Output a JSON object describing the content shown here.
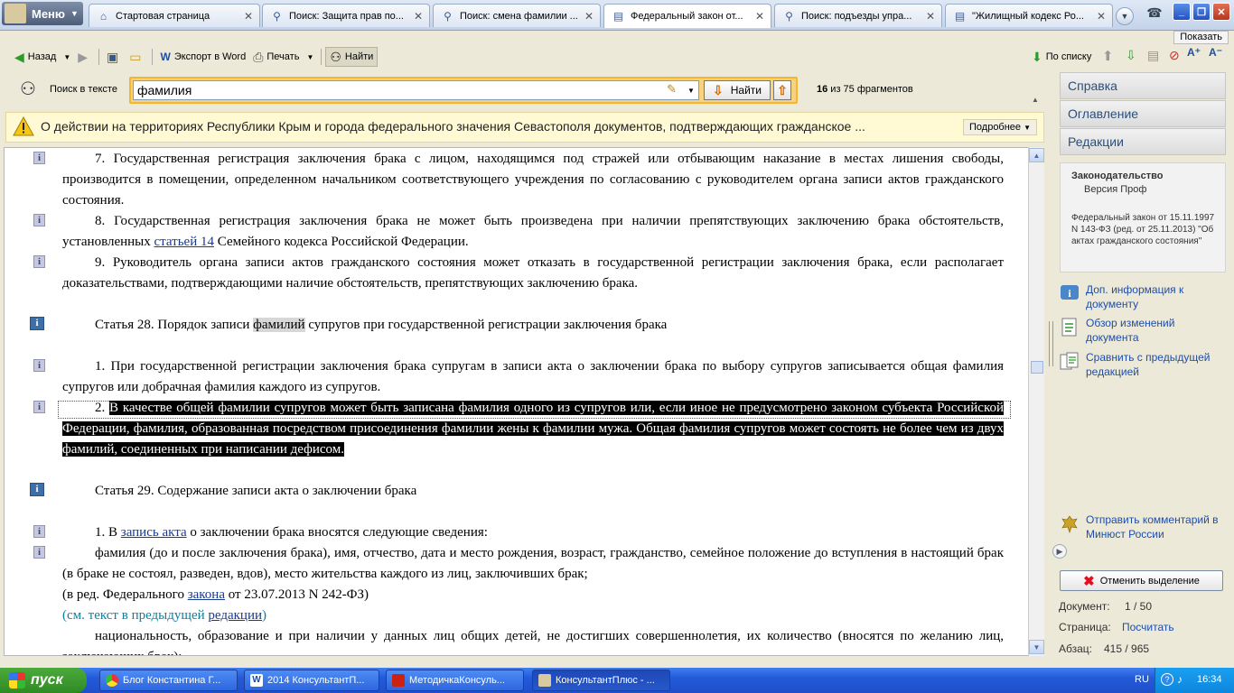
{
  "tabs": {
    "menu_label": "Меню",
    "items": [
      {
        "label": "Стартовая страница"
      },
      {
        "label": "Поиск: Защита прав по..."
      },
      {
        "label": "Поиск: смена фамилии ..."
      },
      {
        "label": "Федеральный закон от..."
      },
      {
        "label": "Поиск: подъезды упра..."
      },
      {
        "label": "\"Жилищный кодекс Ро..."
      }
    ]
  },
  "show_label": "Показать",
  "toolbar": {
    "back": "Назад",
    "export_word": "Экспорт в Word",
    "print": "Печать",
    "find": "Найти",
    "by_list": "По списку"
  },
  "search": {
    "label": "Поиск в тексте",
    "value": "фамилия",
    "find_btn": "Найти",
    "count_current": "16",
    "count_rest": " из 75 фрагментов"
  },
  "notice": {
    "text": "О действии на территориях Республики Крым и города федерального значения Севастополя документов, подтверждающих гражданское ...",
    "more": "Подробнее"
  },
  "document": {
    "p7": "7. Государственная регистрация заключения брака с лицом, находящимся под стражей или отбывающим наказание в местах лишения свободы, производится в помещении, определенном начальником соответствующего учреждения по согласованию с руководителем органа записи актов гражданского состояния.",
    "p8_a": "8. Государственная регистрация заключения брака не может быть произведена при наличии препятствующих заключению брака обстоятельств, установленных ",
    "p8_link": "статьей 14",
    "p8_b": " Семейного кодекса Российской Федерации.",
    "p9": "9. Руководитель органа записи актов гражданского состояния может отказать в государственной регистрации заключения брака, если располагает доказательствами, подтверждающими наличие обстоятельств, препятствующих заключению брака.",
    "art28_a": "Статья 28. Порядок записи ",
    "art28_mark": "фамилий",
    "art28_b": " супругов при государственной регистрации заключения брака",
    "a28p1": "1. При государственной регистрации заключения брака супругам в записи акта о заключении брака по выбору супругов записывается общая фамилия супругов или добрачная фамилия каждого из супругов.",
    "a28p2_num": "2. ",
    "a28p2_hl": "В качестве общей фамилии супругов может быть записана фамилия одного из супругов или, если иное не предусмотрено законом субъекта Российской Федерации, фамилия, образованная посредством присоединения фамилии жены к фамилии мужа. Общая фамилия супругов может состоять не более чем из двух фамилий, соединенных при написании дефисом.",
    "art29": "Статья 29. Содержание записи акта о заключении брака",
    "a29p1_a": "1. В ",
    "a29p1_link": "запись акта",
    "a29p1_b": " о заключении брака вносятся следующие сведения:",
    "a29_item1": "фамилия (до и после заключения брака), имя, отчество, дата и место рождения, возраст, гражданство, семейное положение до вступления в настоящий брак (в браке не состоял, разведен, вдов), место жительства каждого из лиц, заключивших брак;",
    "edit_a": "(в ред. Федерального ",
    "edit_link": "закона",
    "edit_b": " от 23.07.2013 N 242-ФЗ)",
    "prev_a": "(см. текст в предыдущей ",
    "prev_link": "редакции",
    "prev_b": ")",
    "a29_item2": "национальность, образование и при наличии у данных лиц общих детей, не достигших совершеннолетия, их количество (вносятся по желанию лиц, заключающих брак);"
  },
  "right": {
    "help": "Справка",
    "contents": "Оглавление",
    "editions": "Редакции",
    "info_title": "Законодательство",
    "info_sub": "Версия Проф",
    "info_desc": "Федеральный закон от 15.11.1997 N 143-ФЗ (ред. от 25.11.2013) \"Об актах гражданского состояния\"",
    "link_info": "Доп. информация к документу",
    "link_changes": "Обзор изменений документа",
    "link_compare": "Сравнить с предыдущей редакцией",
    "link_comment": "Отправить комментарий в Минюст России",
    "cancel_sel": "Отменить выделение",
    "doc_label": "Документ:",
    "doc_value": "1 / 50",
    "page_label": "Страница:",
    "page_value": "Посчитать",
    "para_label": "Абзац:",
    "para_value": "415 / 965"
  },
  "taskbar": {
    "start": "пуск",
    "items": [
      {
        "label": "Блог Константина Г..."
      },
      {
        "label": "2014 КонсультантП..."
      },
      {
        "label": "МетодичкаКонсуль..."
      },
      {
        "label": "КонсультантПлюс - ..."
      }
    ],
    "lang": "RU",
    "clock": "16:34"
  },
  "colors": {
    "accent_orange": "#f5b431",
    "link_blue": "#1a3a8f",
    "highlight_bg": "#000000",
    "taskbar_blue": "#235ad8"
  }
}
